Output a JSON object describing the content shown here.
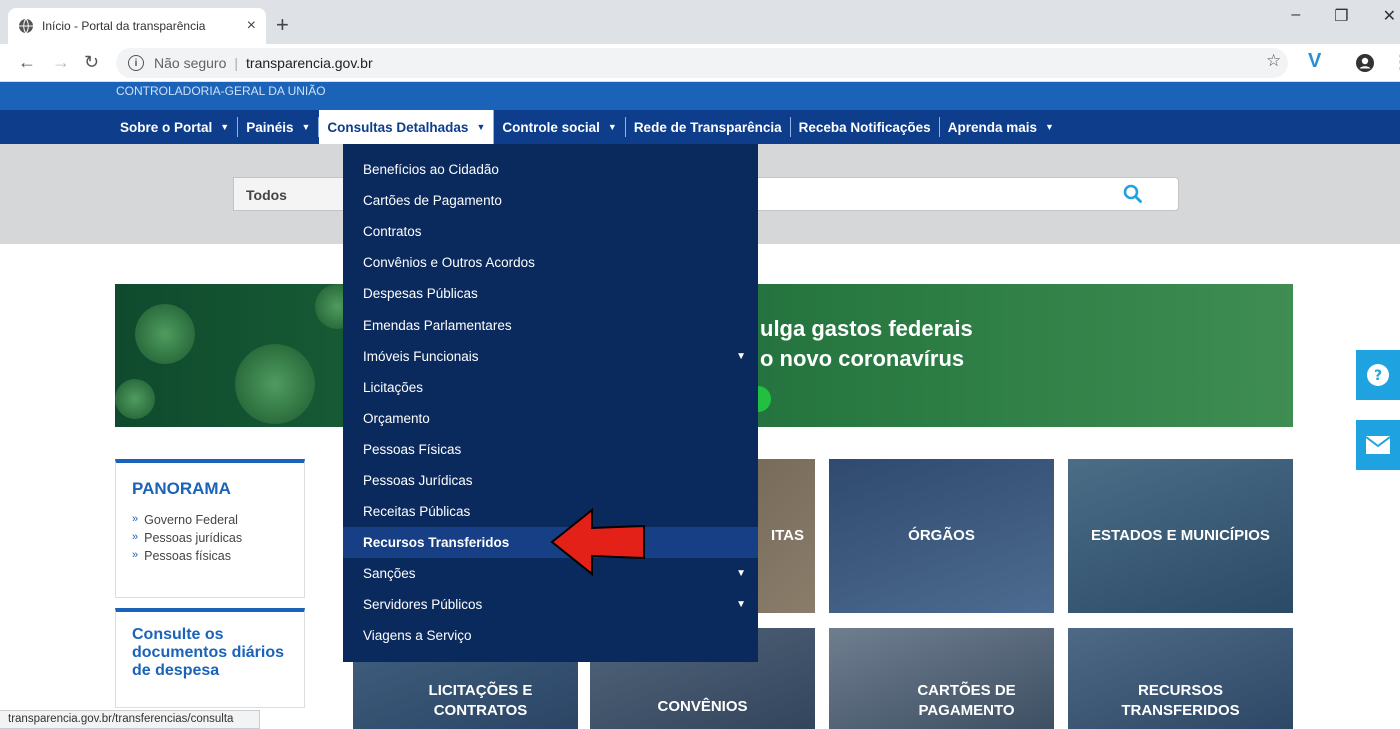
{
  "browser": {
    "tab_title": "Início - Portal da transparência",
    "tab_close": "×",
    "new_tab": "+",
    "insecure_label": "Não seguro",
    "url": "transparencia.gov.br",
    "window_buttons": [
      "–",
      "❐",
      "✕"
    ]
  },
  "site": {
    "agency": "CONTROLADORIA-GERAL DA UNIÃO",
    "nav": [
      {
        "label": "Sobre o Portal",
        "has_caret": true
      },
      {
        "label": "Painéis",
        "has_caret": true
      },
      {
        "label": "Consultas Detalhadas",
        "has_caret": true
      },
      {
        "label": "Controle social",
        "has_caret": true
      },
      {
        "label": "Rede de Transparência",
        "has_caret": false
      },
      {
        "label": "Receba Notificações",
        "has_caret": false
      },
      {
        "label": "Aprenda mais",
        "has_caret": true
      }
    ],
    "search": {
      "select_value": "Todos",
      "placeholder": ""
    },
    "banner": {
      "line1": "ulga gastos federais",
      "line2": "o novo coronavírus"
    },
    "panorama": {
      "title": "PANORAMA",
      "links": [
        "Governo Federal",
        "Pessoas jurídicas",
        "Pessoas físicas"
      ]
    },
    "consulte": "Consulte os documentos diários de despesa",
    "tiles": {
      "receitas": "ITAS",
      "orgaos": "ÓRGÃOS",
      "estados": "ESTADOS E MUNICÍPIOS",
      "licitacoes": "LICITAÇÕES E CONTRATOS",
      "convenios": "CONVÊNIOS",
      "cartoes": "CARTÕES DE PAGAMENTO",
      "recursos": "RECURSOS TRANSFERIDOS"
    },
    "dropdown": [
      {
        "label": "Benefícios ao Cidadão",
        "submenu": false
      },
      {
        "label": "Cartões de Pagamento",
        "submenu": false
      },
      {
        "label": "Contratos",
        "submenu": false
      },
      {
        "label": "Convênios e Outros Acordos",
        "submenu": false
      },
      {
        "label": "Despesas Públicas",
        "submenu": false
      },
      {
        "label": "Emendas Parlamentares",
        "submenu": false
      },
      {
        "label": "Imóveis Funcionais",
        "submenu": true
      },
      {
        "label": "Licitações",
        "submenu": false
      },
      {
        "label": "Orçamento",
        "submenu": false
      },
      {
        "label": "Pessoas Físicas",
        "submenu": false
      },
      {
        "label": "Pessoas Jurídicas",
        "submenu": false
      },
      {
        "label": "Receitas Públicas",
        "submenu": false
      },
      {
        "label": "Recursos Transferidos",
        "submenu": false,
        "highlighted": true
      },
      {
        "label": "Sanções",
        "submenu": true
      },
      {
        "label": "Servidores Públicos",
        "submenu": true
      },
      {
        "label": "Viagens a Serviço",
        "submenu": false
      }
    ],
    "status_url": "transparencia.gov.br/transferencias/consulta"
  },
  "colors": {
    "nav": "#0e3d8c",
    "dropdown": "#0a2a5e",
    "accent": "#1ea3e0",
    "arrow": "#e32119"
  },
  "icons": [
    "globe-icon",
    "back-icon",
    "forward-icon",
    "reload-icon",
    "info-icon",
    "star-icon",
    "extension-icon",
    "account-icon",
    "menu-icon",
    "search-icon",
    "help-icon",
    "mail-icon",
    "red-arrow-icon"
  ]
}
